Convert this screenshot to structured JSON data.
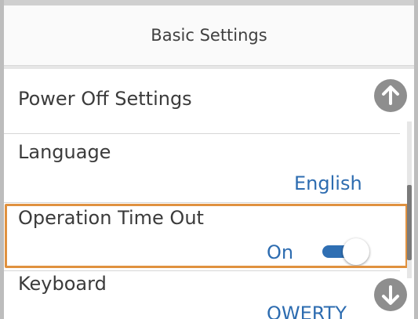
{
  "header": {
    "title": "Basic Settings"
  },
  "list": {
    "items": [
      {
        "label": "Power Off Settings",
        "value": ""
      },
      {
        "label": "Language",
        "value": "English"
      },
      {
        "label": "Operation Time Out",
        "value": "On",
        "toggle_on": true,
        "selected": true
      },
      {
        "label": "Keyboard",
        "value": "QWERTY"
      }
    ]
  },
  "icons": {
    "scroll_up": "arrow-up-icon",
    "scroll_down": "arrow-down-icon"
  },
  "colors": {
    "accent_blue": "#2d6cb0",
    "selection_orange": "#e0913f",
    "scroll_button_gray": "#8e8e8e",
    "text": "#3b3b3b"
  }
}
